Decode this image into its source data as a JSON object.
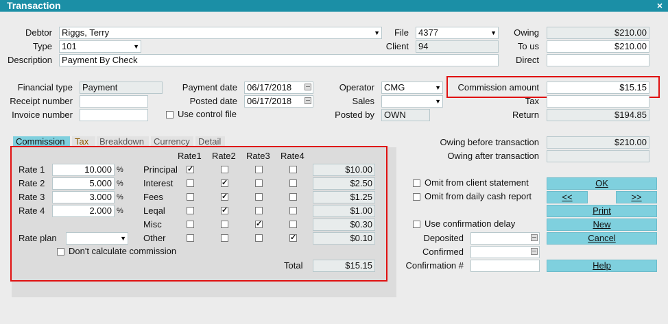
{
  "window": {
    "title": "Transaction",
    "close": "×"
  },
  "header": {
    "debtor_label": "Debtor",
    "debtor_value": "Riggs, Terry",
    "type_label": "Type",
    "type_value": "101",
    "description_label": "Description",
    "description_value": "Payment By Check",
    "file_label": "File",
    "file_value": "4377",
    "client_label": "Client",
    "client_value": "94",
    "owing_label": "Owing",
    "owing_value": "$210.00",
    "tous_label": "To us",
    "tous_value": "$210.00",
    "direct_label": "Direct",
    "direct_value": ""
  },
  "details": {
    "financial_type_label": "Financial type",
    "financial_type_value": "Payment",
    "receipt_label": "Receipt number",
    "receipt_value": "",
    "invoice_label": "Invoice number",
    "invoice_value": "",
    "payment_date_label": "Payment date",
    "payment_date_value": "06/17/2018",
    "posted_date_label": "Posted date",
    "posted_date_value": "06/17/2018",
    "use_control_file_label": "Use control file",
    "operator_label": "Operator",
    "operator_value": "CMG",
    "sales_label": "Sales",
    "sales_value": "",
    "posted_by_label": "Posted by",
    "posted_by_value": "OWN",
    "commission_amount_label": "Commission amount",
    "commission_amount_value": "$15.15",
    "tax_label": "Tax",
    "tax_value": "",
    "return_label": "Return",
    "return_value": "$194.85"
  },
  "tabs": [
    "Commission",
    "Tax",
    "Breakdown",
    "Currency",
    "Detail"
  ],
  "commission": {
    "rate_headers": [
      "Rate1",
      "Rate2",
      "Rate3",
      "Rate4"
    ],
    "rates": [
      {
        "label": "Rate 1",
        "value": "10.000",
        "pct": "%"
      },
      {
        "label": "Rate 2",
        "value": "5.000",
        "pct": "%"
      },
      {
        "label": "Rate 3",
        "value": "3.000",
        "pct": "%"
      },
      {
        "label": "Rate 4",
        "value": "2.000",
        "pct": "%"
      }
    ],
    "rate_plan_label": "Rate plan",
    "rate_plan_value": "",
    "dont_calc_label": "Don't calculate commission",
    "rows": [
      {
        "label": "Principal",
        "checks": [
          true,
          false,
          false,
          false
        ],
        "amount": "$10.00"
      },
      {
        "label": "Interest",
        "checks": [
          false,
          true,
          false,
          false
        ],
        "amount": "$2.50"
      },
      {
        "label": "Fees",
        "checks": [
          false,
          true,
          false,
          false
        ],
        "amount": "$1.25"
      },
      {
        "label": "Leqal",
        "checks": [
          false,
          true,
          false,
          false
        ],
        "amount": "$1.00"
      },
      {
        "label": "Misc",
        "checks": [
          false,
          false,
          true,
          false
        ],
        "amount": "$0.30"
      },
      {
        "label": "Other",
        "checks": [
          false,
          false,
          false,
          true
        ],
        "amount": "$0.10"
      }
    ],
    "total_label": "Total",
    "total_value": "$15.15"
  },
  "right": {
    "owing_before_label": "Owing before transaction",
    "owing_before_value": "$210.00",
    "owing_after_label": "Owing after transaction",
    "owing_after_value": "",
    "omit_client_label": "Omit from client statement",
    "omit_daily_label": "Omit from daily cash report",
    "use_conf_delay_label": "Use confirmation delay",
    "deposited_label": "Deposited",
    "deposited_value": "",
    "confirmed_label": "Confirmed",
    "confirmed_value": "",
    "confirmation_label": "Confirmation #",
    "confirmation_value": ""
  },
  "buttons": {
    "ok": "OK",
    "prev": "<<",
    "next": ">>",
    "print": "Print",
    "new": "New",
    "cancel": "Cancel",
    "help": "Help"
  },
  "colors": {
    "titlebar": "#1b8fa6",
    "accent": "#7fd0de",
    "highlight": "#e01010"
  }
}
